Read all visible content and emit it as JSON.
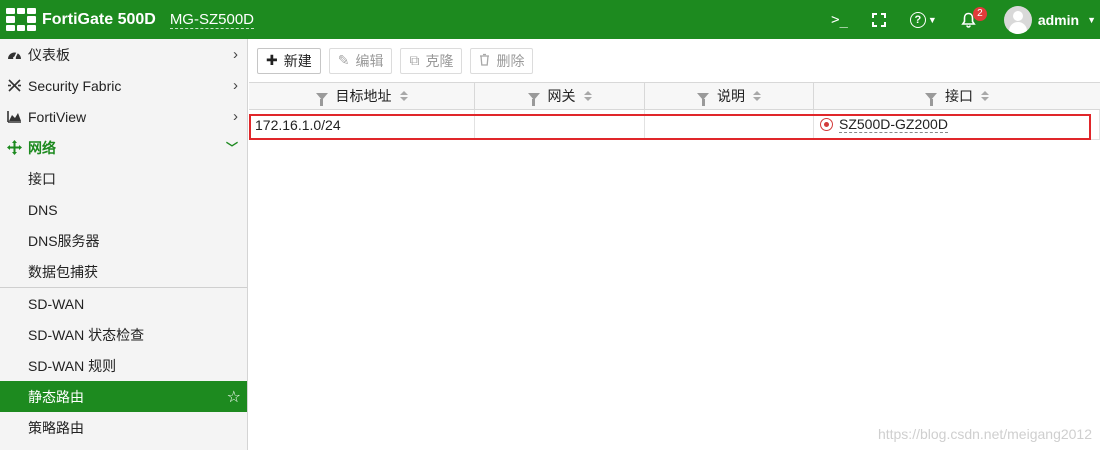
{
  "header": {
    "brand": "FortiGate 500D",
    "hostname": "MG-SZ500D",
    "cli_glyph": ">_",
    "help_glyph": "?",
    "notification_count": "2",
    "user": "admin"
  },
  "sidebar": {
    "items": [
      {
        "label": "仪表板",
        "icon": "dashboard-icon"
      },
      {
        "label": "Security Fabric",
        "icon": "security-fabric-icon"
      },
      {
        "label": "FortiView",
        "icon": "fortiview-icon"
      },
      {
        "label": "网络",
        "icon": "network-icon"
      },
      {
        "label": "接口"
      },
      {
        "label": "DNS"
      },
      {
        "label": "DNS服务器"
      },
      {
        "label": "数据包捕获"
      },
      {
        "label": "SD-WAN"
      },
      {
        "label": "SD-WAN 状态检查"
      },
      {
        "label": "SD-WAN 规则"
      },
      {
        "label": "静态路由"
      },
      {
        "label": "策略路由"
      }
    ]
  },
  "toolbar": {
    "new_label": "新建",
    "edit_label": "编辑",
    "clone_label": "克隆",
    "delete_label": "删除"
  },
  "table": {
    "columns": [
      "目标地址",
      "网关",
      "说明",
      "接口"
    ],
    "rows": [
      {
        "destination": "172.16.1.0/24",
        "gateway": "",
        "comment": "",
        "interface": "SZ500D-GZ200D"
      }
    ]
  },
  "watermark": "https://blog.csdn.net/meigang2012",
  "colors": {
    "accent": "#1d8a1f",
    "highlight_border": "#e0262a",
    "badge": "#e23b3b"
  }
}
